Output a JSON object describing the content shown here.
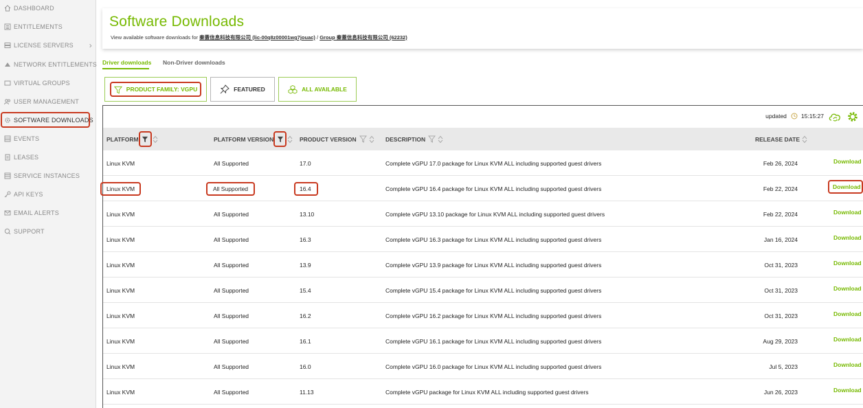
{
  "sidebar": {
    "items": [
      {
        "label": "DASHBOARD",
        "icon": "home-icon"
      },
      {
        "label": "ENTITLEMENTS",
        "icon": "list-icon"
      },
      {
        "label": "LICENSE SERVERS",
        "icon": "server-icon"
      },
      {
        "label": "NETWORK ENTITLEMENTS",
        "icon": "network-icon"
      },
      {
        "label": "VIRTUAL GROUPS",
        "icon": "folder-icon"
      },
      {
        "label": "USER MANAGEMENT",
        "icon": "users-icon"
      },
      {
        "label": "SOFTWARE DOWNLOADS",
        "icon": "gear-icon"
      },
      {
        "label": "EVENTS",
        "icon": "grid-icon"
      },
      {
        "label": "LEASES",
        "icon": "document-icon"
      },
      {
        "label": "SERVICE INSTANCES",
        "icon": "stack-icon"
      },
      {
        "label": "API KEYS",
        "icon": "key-icon"
      },
      {
        "label": "EMAIL ALERTS",
        "icon": "envelope-icon"
      },
      {
        "label": "SUPPORT",
        "icon": "support-icon"
      }
    ],
    "chevron": "›"
  },
  "header": {
    "title": "Software Downloads",
    "subtitle_prefix": "View available software downloads for",
    "org": "秦蓋信息科技有限公司 (lic-00q8z00001wg7jouac)",
    "separator": "/",
    "group": "Group 秦蓋信息科技有限公司 (62232)"
  },
  "tabs": [
    {
      "label": "Driver downloads",
      "active": true
    },
    {
      "label": "Non-Driver downloads",
      "active": false
    }
  ],
  "filters": {
    "product_family": "PRODUCT FAMILY: VGPU",
    "featured": "FEATURED",
    "all_available": "ALL AVAILABLE"
  },
  "toolbar": {
    "updated_label": "updated",
    "time": "15:15:27"
  },
  "columns": {
    "platform": "PLATFORM",
    "platform_version": "PLATFORM VERSION",
    "product_version": "PRODUCT VERSION",
    "description": "DESCRIPTION",
    "release_date": "RELEASE DATE"
  },
  "download_label": "Download",
  "rows": [
    {
      "platform": "Linux KVM",
      "platform_version": "All Supported",
      "product_version": "17.0",
      "description": "Complete vGPU 17.0 package for Linux KVM ALL including supported guest drivers",
      "release_date": "Feb 26, 2024"
    },
    {
      "platform": "Linux KVM",
      "platform_version": "All Supported",
      "product_version": "16.4",
      "description": "Complete vGPU 16.4 package for Linux KVM ALL including supported guest drivers",
      "release_date": "Feb 22, 2024"
    },
    {
      "platform": "Linux KVM",
      "platform_version": "All Supported",
      "product_version": "13.10",
      "description": "Complete vGPU 13.10 package for Linux KVM ALL including supported guest drivers",
      "release_date": "Feb 22, 2024"
    },
    {
      "platform": "Linux KVM",
      "platform_version": "All Supported",
      "product_version": "16.3",
      "description": "Complete vGPU 16.3 package for Linux KVM ALL including supported guest drivers",
      "release_date": "Jan 16, 2024"
    },
    {
      "platform": "Linux KVM",
      "platform_version": "All Supported",
      "product_version": "13.9",
      "description": "Complete vGPU 13.9 package for Linux KVM ALL including supported guest drivers",
      "release_date": "Oct 31, 2023"
    },
    {
      "platform": "Linux KVM",
      "platform_version": "All Supported",
      "product_version": "15.4",
      "description": "Complete vGPU 15.4 package for Linux KVM ALL including supported guest drivers",
      "release_date": "Oct 31, 2023"
    },
    {
      "platform": "Linux KVM",
      "platform_version": "All Supported",
      "product_version": "16.2",
      "description": "Complete vGPU 16.2 package for Linux KVM ALL including supported guest drivers",
      "release_date": "Oct 31, 2023"
    },
    {
      "platform": "Linux KVM",
      "platform_version": "All Supported",
      "product_version": "16.1",
      "description": "Complete vGPU 16.1 package for Linux KVM ALL including supported guest drivers",
      "release_date": "Aug 29, 2023"
    },
    {
      "platform": "Linux KVM",
      "platform_version": "All Supported",
      "product_version": "16.0",
      "description": "Complete vGPU 16.0 package for Linux KVM ALL including supported guest drivers",
      "release_date": "Jul 5, 2023"
    },
    {
      "platform": "Linux KVM",
      "platform_version": "All Supported",
      "product_version": "11.13",
      "description": "Complete vGPU package for Linux KVM ALL including supported guest drivers",
      "release_date": "Jun 26, 2023"
    }
  ],
  "colors": {
    "accent": "#76b900",
    "highlight": "#c8391f"
  }
}
